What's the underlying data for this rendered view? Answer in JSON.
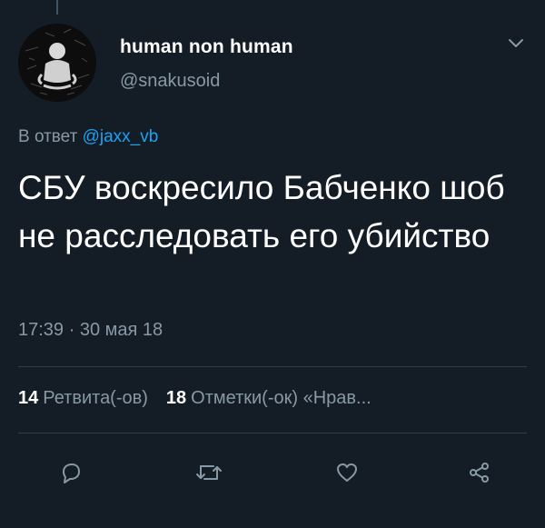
{
  "tweet": {
    "display_name": "human non human",
    "handle": "@snakusoid",
    "reply_prefix": "В ответ",
    "reply_mention": "@jaxx_vb",
    "text": "СБУ воскресило Бабченко шоб не расследовать его убийство",
    "timestamp": "17:39 · 30 мая 18"
  },
  "stats": {
    "retweets_count": "14",
    "retweets_label": "Ретвита(-ов)",
    "likes_count": "18",
    "likes_label": "Отметки(-ок) «Нрав..."
  },
  "actions": {
    "icons": [
      "reply-icon",
      "retweet-icon",
      "like-icon",
      "share-icon"
    ]
  },
  "colors": {
    "background": "#141d26",
    "text": "#ffffff",
    "secondary": "#8899a6",
    "link": "#1da1f2",
    "divider": "#2f3d4b"
  }
}
